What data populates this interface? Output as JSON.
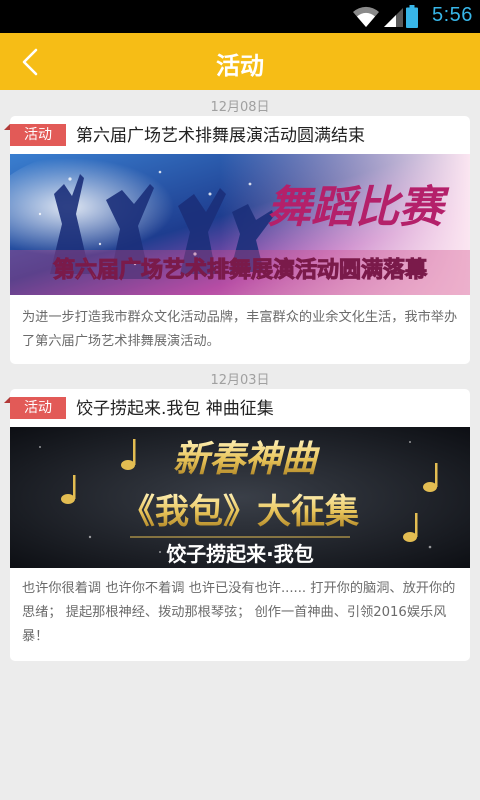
{
  "status_bar": {
    "time": "5:56",
    "icons": [
      "wifi-icon",
      "signal-icon",
      "battery-icon"
    ]
  },
  "header": {
    "title": "活动",
    "back_icon": "chevron-left-icon"
  },
  "colors": {
    "header_bg": "#f6bd16",
    "tag_bg": "#e25a57",
    "page_bg": "#ececec",
    "time_color": "#38b6e8"
  },
  "activities": [
    {
      "date": "12月08日",
      "tag": "活动",
      "title": "第六届广场艺术排舞展演活动圆满结束",
      "banner": {
        "caption": "第六届广场艺术排舞展演活动圆满落幕",
        "art_text": "舞蹈比赛"
      },
      "description": "为进一步打造我市群众文化活动品牌，丰富群众的业余文化生活，我市举办了第六届广场艺术排舞展演活动。"
    },
    {
      "date": "12月03日",
      "tag": "活动",
      "title": "饺子捞起来.我包 神曲征集",
      "banner": {
        "headline": "新春神曲",
        "subtitle": "《我包》大征集",
        "footer": "饺子捞起来·我包"
      },
      "description": "也许你很着调 也许你不着调 也许已没有也许...... 打开你的脑洞、放开你的思绪； 提起那根神经、拨动那根琴弦； 创作一首神曲、引领2016娱乐风暴！"
    }
  ]
}
